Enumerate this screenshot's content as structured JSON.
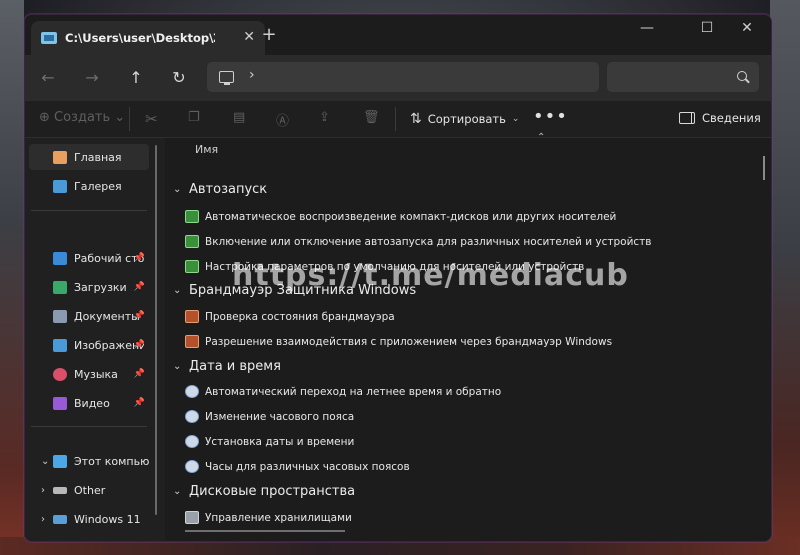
{
  "titlebar": {
    "tab_title": "C:\\Users\\user\\Desktop\\Zippo",
    "tab_close": "✕",
    "new_tab": "+",
    "minimize": "—",
    "maximize": "☐",
    "close": "✕"
  },
  "navbar": {
    "back": "←",
    "forward": "→",
    "up": "↑",
    "refresh": "↻",
    "address_chevron": "›"
  },
  "toolbar": {
    "create_label": "Создать",
    "sort_label": "Сортировать",
    "more_label": "•••",
    "details_label": "Сведения"
  },
  "sidebar": {
    "items": [
      {
        "label": "Главная",
        "icon": "home-icon"
      },
      {
        "label": "Галерея",
        "icon": "gallery-icon"
      },
      {
        "label": "Рабочий сто",
        "icon": "desktop-icon"
      },
      {
        "label": "Загрузки",
        "icon": "downloads-icon"
      },
      {
        "label": "Документы",
        "icon": "documents-icon"
      },
      {
        "label": "Изображени",
        "icon": "pictures-icon"
      },
      {
        "label": "Музыка",
        "icon": "music-icon"
      },
      {
        "label": "Видео",
        "icon": "video-icon"
      },
      {
        "label": "Этот компьюте",
        "icon": "computer-icon"
      },
      {
        "label": "Other",
        "icon": "drive-icon"
      },
      {
        "label": "Windows 11",
        "icon": "windows-drive-icon"
      }
    ]
  },
  "content": {
    "column_name": "Имя",
    "groups": [
      {
        "title": "Автозапуск",
        "items": [
          "Автоматическое воспроизведение компакт-дисков или других носителей",
          "Включение или отключение автозапуска для различных носителей и устройств",
          "Настройка параметров по умолчанию для носителей или устройств"
        ]
      },
      {
        "title": "Брандмауэр Защитника Windows",
        "items": [
          "Проверка состояния брандмауэра",
          "Разрешение взаимодействия с приложением через брандмауэр Windows"
        ]
      },
      {
        "title": "Дата и время",
        "items": [
          "Автоматический переход на летнее время и обратно",
          "Изменение часового пояса",
          "Установка даты и времени",
          "Часы для различных часовых поясов"
        ]
      },
      {
        "title": "Дисковые пространства",
        "items": [
          "Управление хранилищами"
        ]
      }
    ]
  },
  "watermark": "https://t.me/mediacub"
}
